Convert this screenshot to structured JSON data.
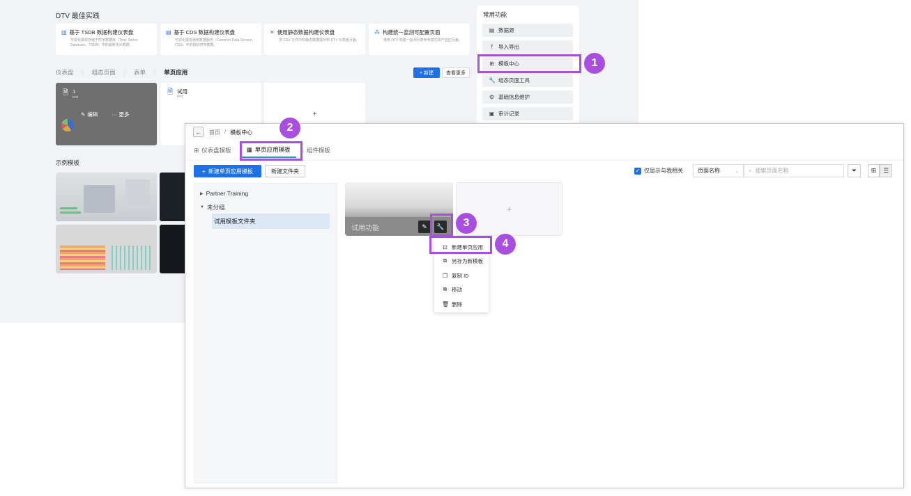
{
  "background": {
    "title": "DTV 最佳实践",
    "best_practice_cards": [
      {
        "title": "基于 TSDB 数据构建仪表盘",
        "desc": "可现化展现存储于时序数据库（Time Series Database，TSDB）中的最新测点数据。",
        "icon": "tsdb-icon"
      },
      {
        "title": "基于 CDS 数据构建仪表盘",
        "desc": "可现化展现通用数据服务（Common Data Service，CDS）中的指标时序数据。",
        "icon": "cds-icon"
      },
      {
        "title": "使用静态数据构建仪表盘",
        "desc": "将 CSV 文件中的静态数据展示到 DTV 仪表盘页面。",
        "icon": "static-data-icon"
      },
      {
        "title": "构建统一监测可配置页面",
        "desc": "使用 DTV 构建一监测列表参考模式资产监控页面。",
        "icon": "monitor-icon"
      }
    ],
    "tabs": [
      "仪表盘",
      "组态页面",
      "表单",
      "单页应用"
    ],
    "new_label": "+ 新建",
    "more_label": "查看更多",
    "dash_cards": [
      {
        "name": "1",
        "sub": "test",
        "edit": "编辑",
        "more": "更多"
      },
      {
        "name": "试用",
        "sub": "test"
      }
    ],
    "add_symbol": "+",
    "sample_title": "示例模板",
    "sidebar": {
      "title": "常用功能",
      "items": [
        {
          "label": "数据源",
          "icon": "database-icon"
        },
        {
          "label": "导入导出",
          "icon": "upload-icon"
        },
        {
          "label": "模板中心",
          "icon": "template-icon"
        },
        {
          "label": "组态页面工具",
          "icon": "wrench-icon"
        },
        {
          "label": "基础信息维护",
          "icon": "settings-icon"
        },
        {
          "label": "审计记录",
          "icon": "audit-icon"
        }
      ]
    }
  },
  "window": {
    "breadcrumb": {
      "home": "首页",
      "sep": "/",
      "current": "模板中心"
    },
    "tabs": [
      {
        "label": "仪表盘模板",
        "icon": "dashboard-icon"
      },
      {
        "label": "单页应用模板",
        "icon": "single-page-icon"
      },
      {
        "label": "组件模板",
        "icon": "component-icon"
      }
    ],
    "new_page_btn": "新建单页应用模板",
    "new_folder_btn": "新建文件夹",
    "only_mine": "仅显示与我相关",
    "sort": "页面名称",
    "search_placeholder": "搜索页面名称",
    "tree": {
      "nodes": [
        "Partner Training",
        "未分组"
      ],
      "selected": "试用模板文件夹"
    },
    "template_card": {
      "name": "试用功能"
    },
    "add_symbol": "+",
    "menu": [
      {
        "label": "新建单页应用",
        "icon": "new-page-icon"
      },
      {
        "label": "另存为新模板",
        "icon": "save-as-icon"
      },
      {
        "label": "复制 ID",
        "icon": "copy-icon"
      },
      {
        "label": "移动",
        "icon": "move-icon"
      },
      {
        "label": "删除",
        "icon": "delete-icon"
      }
    ]
  },
  "callouts": [
    "1",
    "2",
    "3",
    "4"
  ],
  "colors": {
    "accent": "#1f6fe5",
    "callout": "#a94fe0",
    "tab_underline": "#16a6a0"
  }
}
